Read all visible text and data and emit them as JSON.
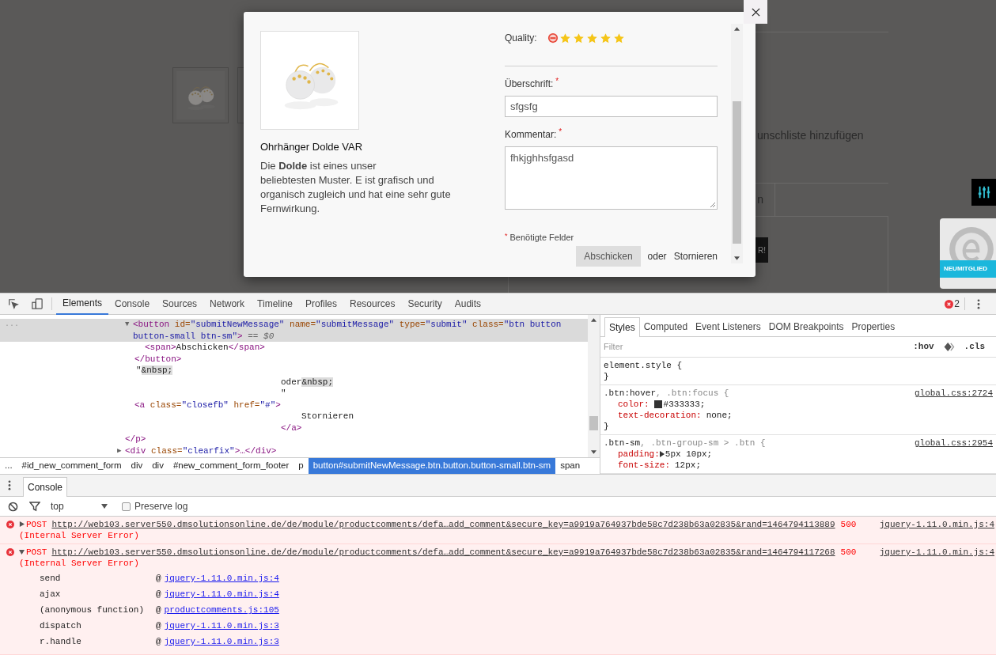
{
  "page_behind": {
    "wishlist_link": "unschliste hinzufügen",
    "tab_label": "n",
    "button_label": "R!",
    "badge_label": "NEUMITGLIED"
  },
  "modal": {
    "product": {
      "name": "Ohrhänger Dolde VAR",
      "description": [
        "Die **Dolde** ist eines unser",
        "beliebtesten Muster. E ist grafisch und organisch zugleich und hat eine sehr gute Fernwirkung."
      ]
    },
    "quality": {
      "label": "Quality:",
      "stars": 5
    },
    "fields": [
      {
        "kind": "input",
        "label": "Überschrift:",
        "required_mark": "*",
        "value": "sfgsfg"
      },
      {
        "kind": "textarea",
        "label": "Kommentar:",
        "required_mark": "*",
        "value": "fhkjghhsfgasd"
      }
    ],
    "required_note": {
      "mark": "*",
      "text": "Benötigte Felder"
    },
    "submit_button": "Abschicken",
    "or_text": "oder",
    "cancel_link": "Stornieren"
  },
  "devtools": {
    "tabs": [
      {
        "label": "Elements",
        "selected": true
      },
      {
        "label": "Console",
        "selected": false
      },
      {
        "label": "Sources",
        "selected": false
      },
      {
        "label": "Network",
        "selected": false
      },
      {
        "label": "Timeline",
        "selected": false
      },
      {
        "label": "Profiles",
        "selected": false
      },
      {
        "label": "Resources",
        "selected": false
      },
      {
        "label": "Security",
        "selected": false
      },
      {
        "label": "Audits",
        "selected": false
      }
    ],
    "error_count": "2",
    "dom_lines": [
      {
        "kind": "open",
        "selected": true,
        "gutter": "...",
        "expander": "▼",
        "segments": [
          {
            "kind": "tag",
            "text": "<button"
          },
          {
            "kind": "attr",
            "text": " id="
          },
          {
            "kind": "value",
            "text": "\"submitNewMessage\""
          },
          {
            "kind": "attr",
            "text": " name="
          },
          {
            "kind": "value",
            "text": "\"submitMessage\""
          },
          {
            "kind": "attr",
            "text": " type="
          },
          {
            "kind": "value",
            "text": "\"submit\""
          },
          {
            "kind": "attr",
            "text": " class="
          },
          {
            "kind": "value",
            "text": "\"btn button button-small btn-sm\""
          },
          {
            "kind": "tag",
            "text": ">"
          },
          {
            "kind": "meta",
            "text": " == $0"
          }
        ]
      },
      {
        "kind": "inner",
        "selected": false,
        "segments": [
          {
            "kind": "tag",
            "text": "<span>"
          },
          {
            "kind": "text",
            "text": "Abschicken"
          },
          {
            "kind": "tag",
            "text": "</span>"
          }
        ]
      },
      {
        "kind": "close",
        "selected": false,
        "segments": [
          {
            "kind": "tag",
            "text": "</button>"
          }
        ]
      },
      {
        "kind": "text",
        "selected": false,
        "segments": [
          {
            "kind": "text",
            "text": "\""
          },
          {
            "kind": "entity",
            "text": "&nbsp;"
          }
        ]
      },
      {
        "kind": "text_cont",
        "selected": false,
        "segments": [
          {
            "kind": "text",
            "text": "oder"
          },
          {
            "kind": "entity",
            "text": "&nbsp;"
          }
        ]
      },
      {
        "kind": "text_cont",
        "selected": false,
        "segments": [
          {
            "kind": "text",
            "text": "\""
          }
        ]
      },
      {
        "kind": "close",
        "selected": false,
        "segments": [
          {
            "kind": "tag",
            "text": "<a"
          },
          {
            "kind": "attr",
            "text": " class="
          },
          {
            "kind": "value",
            "text": "\"closefb\""
          },
          {
            "kind": "attr",
            "text": " href="
          },
          {
            "kind": "value",
            "text": "\"#\""
          },
          {
            "kind": "tag",
            "text": ">"
          }
        ]
      },
      {
        "kind": "text_deep",
        "selected": false,
        "segments": [
          {
            "kind": "text",
            "text": "Stornieren"
          }
        ]
      },
      {
        "kind": "text_cont",
        "selected": false,
        "segments": [
          {
            "kind": "tag",
            "text": "</a>"
          }
        ]
      },
      {
        "kind": "parent_close",
        "selected": false,
        "segments": [
          {
            "kind": "tag",
            "text": "</p>"
          }
        ]
      },
      {
        "kind": "sibling",
        "selected": false,
        "expander": "▶",
        "segments": [
          {
            "kind": "tag",
            "text": "<div"
          },
          {
            "kind": "attr",
            "text": " class="
          },
          {
            "kind": "value",
            "text": "\"clearfix\""
          },
          {
            "kind": "tag",
            "text": ">…</div>"
          }
        ]
      }
    ],
    "breadcrumbs": [
      {
        "label": "...",
        "selected": false
      },
      {
        "label": "#id_new_comment_form",
        "selected": false
      },
      {
        "label": "div",
        "selected": false
      },
      {
        "label": "div",
        "selected": false
      },
      {
        "label": "#new_comment_form_footer",
        "selected": false
      },
      {
        "label": "p",
        "selected": false
      },
      {
        "label": "button#submitNewMessage.btn.button.button-small.btn-sm",
        "selected": true
      },
      {
        "label": "span",
        "selected": false
      }
    ],
    "styles": {
      "tabs": [
        {
          "label": "Styles",
          "selected": true
        },
        {
          "label": "Computed",
          "selected": false
        },
        {
          "label": "Event Listeners",
          "selected": false
        },
        {
          "label": "DOM Breakpoints",
          "selected": false
        },
        {
          "label": "Properties",
          "selected": false
        }
      ],
      "filter_placeholder": "Filter",
      "hov": ":hov",
      "cls": ".cls",
      "rules": [
        {
          "selector": [
            {
              "text": "element.style {",
              "matched": true
            }
          ],
          "close": "}"
        },
        {
          "selector": [
            {
              "text": ".btn:hover",
              "matched": true
            },
            {
              "text": ", .btn:focus {",
              "matched": false
            }
          ],
          "source": "global.css:2724",
          "close": "}",
          "properties": [
            {
              "name": "color:",
              "value": "#333333;",
              "color": "#333333"
            },
            {
              "name": "text-decoration:",
              "value": "none;"
            }
          ]
        },
        {
          "selector": [
            {
              "text": ".btn-sm",
              "matched": true
            },
            {
              "text": ", .btn-group-sm > .btn {",
              "matched": false
            }
          ],
          "source": "global.css:2954",
          "properties": [
            {
              "name": "padding:",
              "value": "5px 10px;",
              "expandable": true
            },
            {
              "name": "font-size:",
              "value": "12px;"
            }
          ]
        }
      ]
    }
  },
  "console": {
    "tab": "Console",
    "context": "top",
    "preserve_log": {
      "label": "Preserve log",
      "checked": false
    },
    "messages": [
      {
        "expanded": false,
        "method": "POST",
        "url": "http://web103.server550.dmsolutionsonline.de/de/module/productcomments/defa…add_comment&secure_key=a9919a764937bde58c7d238b63a02835&rand=1464794113889",
        "status": "500",
        "detail": "(Internal Server Error)",
        "source": "jquery-1.11.0.min.js:4"
      },
      {
        "expanded": true,
        "method": "POST",
        "url": "http://web103.server550.dmsolutionsonline.de/de/module/productcomments/defa…add_comment&secure_key=a9919a764937bde58c7d238b63a02835&rand=1464794117268",
        "status": "500",
        "detail": "(Internal Server Error)",
        "source": "jquery-1.11.0.min.js:4",
        "stack": [
          {
            "fn": "send",
            "at": "@",
            "file": "jquery-1.11.0.min.js:4"
          },
          {
            "fn": "ajax",
            "at": "@",
            "file": "jquery-1.11.0.min.js:4"
          },
          {
            "fn": "(anonymous function)",
            "at": "@",
            "file": "productcomments.js:105"
          },
          {
            "fn": "dispatch",
            "at": "@",
            "file": "jquery-1.11.0.min.js:3"
          },
          {
            "fn": "r.handle",
            "at": "@",
            "file": "jquery-1.11.0.min.js:3"
          }
        ]
      }
    ]
  }
}
